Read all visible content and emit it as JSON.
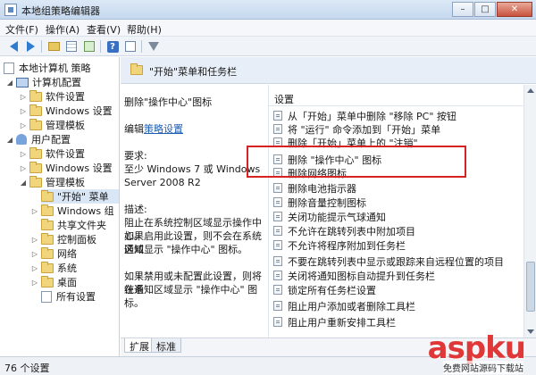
{
  "window": {
    "title": "本地组策略编辑器",
    "buttons": [
      "–",
      "□",
      "✕"
    ]
  },
  "menubar": {
    "items": [
      "文件(F)",
      "操作(A)",
      "查看(V)",
      "帮助(H)"
    ]
  },
  "toolbar": {
    "buttons": [
      "back-icon",
      "forward-icon",
      "up-folder-icon",
      "show-hide-tree-icon",
      "export-list-icon",
      "help-icon",
      "properties-icon",
      "filter-icon"
    ]
  },
  "tree": {
    "items": [
      {
        "label": "本地计算机 策略",
        "level": 0,
        "icon": "computer-policy-icon"
      },
      {
        "label": "计算机配置",
        "level": 1,
        "icon": "computer-icon",
        "expand": "◢"
      },
      {
        "label": "软件设置",
        "level": 2,
        "icon": "folder-icon",
        "expand": "▷"
      },
      {
        "label": "Windows 设置",
        "level": 2,
        "icon": "folder-icon",
        "expand": "▷"
      },
      {
        "label": "管理模板",
        "level": 2,
        "icon": "folder-icon",
        "expand": "▷"
      },
      {
        "label": "用户配置",
        "level": 1,
        "icon": "user-icon",
        "expand": "◢"
      },
      {
        "label": "软件设置",
        "level": 2,
        "icon": "folder-icon",
        "expand": "▷"
      },
      {
        "label": "Windows 设置",
        "level": 2,
        "icon": "folder-icon",
        "expand": "▷"
      },
      {
        "label": "管理模板",
        "level": 2,
        "icon": "folder-icon",
        "expand": "◢"
      },
      {
        "label": "\"开始\" 菜单",
        "level": 3,
        "icon": "folder-icon",
        "selected": true
      },
      {
        "label": "Windows 组",
        "level": 3,
        "icon": "folder-icon",
        "expand": "▷"
      },
      {
        "label": "共享文件夹",
        "level": 3,
        "icon": "folder-icon"
      },
      {
        "label": "控制面板",
        "level": 3,
        "icon": "folder-icon",
        "expand": "▷"
      },
      {
        "label": "网络",
        "level": 3,
        "icon": "folder-icon",
        "expand": "▷"
      },
      {
        "label": "系统",
        "level": 3,
        "icon": "folder-icon",
        "expand": "▷"
      },
      {
        "label": "桌面",
        "level": 3,
        "icon": "folder-icon",
        "expand": "▷"
      },
      {
        "label": "所有设置",
        "level": 3,
        "icon": "all-settings-icon"
      }
    ]
  },
  "header": {
    "title": "\"开始\"菜单和任务栏"
  },
  "description": {
    "title": "删除\"操作中心\"图标",
    "edit_prefix": "编辑",
    "edit_link": "策略设置",
    "requirements_label": "要求:",
    "requirements_line1": "至少 Windows 7 或 Windows",
    "requirements_line2": "Server 2008 R2",
    "desc_label": "描述:",
    "desc_lines": [
      "阻止在系统控制区域显示操作中心。",
      "如果启用此设置，则不会在系统通知",
      "区域显示 \"操作中心\" 图标。",
      "",
      "如果禁用或未配置此设置，则将在系",
      "统通知区域显示 \"操作中心\" 图标。"
    ]
  },
  "settings": {
    "header": "设置",
    "items": [
      "从「开始」菜单中删除 \"移除 PC\" 按钮",
      "将 \"运行\" 命令添加到「开始」菜单",
      "删除「开始」菜单上的 \"注销\"",
      "删除 \"操作中心\" 图标",
      "删除网络图标",
      "删除电池指示器",
      "删除音量控制图标",
      "关闭功能提示气球通知",
      "不允许在跳转列表中附加项目",
      "不允许将程序附加到任务栏",
      "不要在跳转列表中显示或跟踪来自远程位置的项目",
      "关闭将通知图标自动提升到任务栏",
      "锁定所有任务栏设置",
      "阻止用户添加或者删除工具栏",
      "阻止用户重新安排工具栏"
    ]
  },
  "tabs": [
    "扩展",
    "标准"
  ],
  "status": {
    "text": "76 个设置"
  },
  "watermark": {
    "main": "aspku",
    "sub": "免费网站源码下载站"
  },
  "colors": {
    "highlight": "#d62222",
    "link": "#1f5fb4",
    "watermark": "#e03838"
  }
}
